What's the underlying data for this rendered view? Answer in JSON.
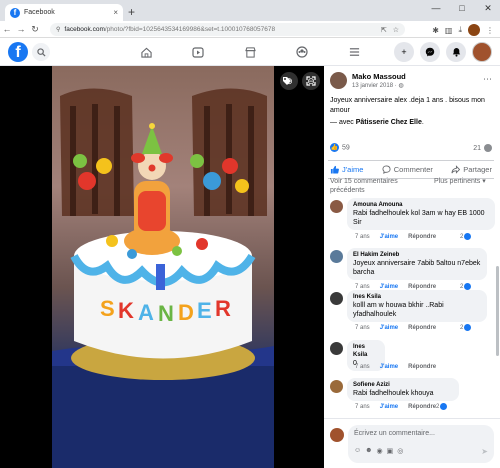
{
  "browser": {
    "tab_title": "Facebook",
    "tab_close": "×",
    "new_tab": "+",
    "url_host": "facebook.com",
    "url_path": "/photo/?fbid=1025643534169986&set=t.100010768057678",
    "window_controls": [
      "—",
      "□",
      "✕"
    ]
  },
  "fb": {
    "logo": "f",
    "nav_icons": [
      "home-icon",
      "video-icon",
      "marketplace-icon",
      "groups-icon",
      "menu-icon"
    ]
  },
  "post": {
    "author": "Mako Massoud",
    "date": "13 janvier 2018 · ",
    "text": "Joyeux anniversaire alex .deja 1 ans . bisous mon amour",
    "with_prefix": "— avec ",
    "with_page": "Pâtisserie Chez Elle",
    "with_suffix": ".",
    "like_count": "59",
    "share_count": "21",
    "actions": {
      "like": "J'aime",
      "comment": "Commenter",
      "share": "Partager"
    },
    "prev_comments": "Voir 15 commentaires précédents",
    "sort": "Plus pertinents ▾"
  },
  "comments": [
    {
      "name": "Amouna Amouna",
      "text": "Rabi fadhelhoulek kol 3am w hay EB 1000 Sir",
      "time": "7 ans",
      "like": "J'aime",
      "reply": "Répondre",
      "reacts": "2",
      "avatar_color": "#8a5a44"
    },
    {
      "name": "El Hakim Zeineb",
      "text": "Joyeux anniversaire 7abib 5altou n7ebek barcha",
      "time": "7 ans",
      "like": "J'aime",
      "reply": "Répondre",
      "reacts": "2",
      "avatar_color": "#5a7a9a"
    },
    {
      "name": "Ines Ksila",
      "text": "kolll am w houwa bkhir ..Rabi yfadhalhoulek",
      "time": "7 ans",
      "like": "J'aime",
      "reply": "Répondre",
      "reacts": "2",
      "avatar_color": "#3a3a3a"
    },
    {
      "name": "Ines Ksila",
      "text": "0",
      "time": "7 ans",
      "like": "J'aime",
      "reply": "Répondre",
      "reacts": "",
      "avatar_color": "#3a3a3a"
    },
    {
      "name": "Sofiene Azizi",
      "text": "Rabi fadhelhoulek khouya",
      "time": "7 ans",
      "like": "J'aime",
      "reply": "Répondre",
      "reacts": "2",
      "avatar_color": "#9a6a3a"
    }
  ],
  "composer": {
    "placeholder": "Écrivez un commentaire..."
  }
}
